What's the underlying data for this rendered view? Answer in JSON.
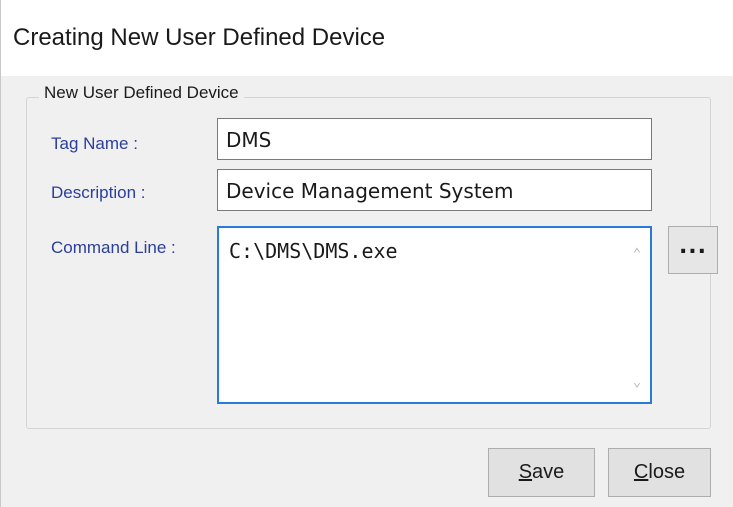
{
  "window": {
    "title": "Creating New User Defined Device"
  },
  "group": {
    "legend": "New User Defined Device"
  },
  "fields": {
    "tag_name": {
      "label": "Tag Name :",
      "value": "DMS"
    },
    "description": {
      "label": "Description :",
      "value": "Device Management System"
    },
    "command_line": {
      "label": "Command Line :",
      "value": "C:\\DMS\\DMS.exe"
    }
  },
  "buttons": {
    "browse": "...",
    "save": {
      "mnemonic": "S",
      "rest": "ave"
    },
    "close": {
      "mnemonic": "C",
      "rest": "lose"
    }
  },
  "icons": {
    "scroll_up": "chevron-up-icon",
    "scroll_down": "chevron-down-icon"
  },
  "colors": {
    "label_text": "#2b3e9a",
    "focus_border": "#2a7bd6",
    "title_bar": "#ffffff",
    "dialog_bg": "#f0f0f0"
  }
}
